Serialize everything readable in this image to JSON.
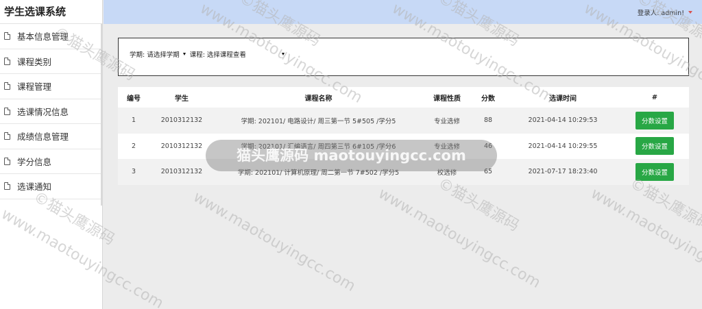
{
  "app": {
    "title": "学生选课系统"
  },
  "header": {
    "user_label": "登录人: admin!"
  },
  "sidebar": {
    "items": [
      {
        "label": "基本信息管理",
        "icon": "document-icon"
      },
      {
        "label": "课程类别",
        "icon": "document-icon"
      },
      {
        "label": "课程管理",
        "icon": "document-icon"
      },
      {
        "label": "选课情况信息",
        "icon": "document-icon"
      },
      {
        "label": "成绩信息管理",
        "icon": "document-icon"
      },
      {
        "label": "学分信息",
        "icon": "document-icon"
      },
      {
        "label": "选课通知",
        "icon": "document-icon"
      }
    ]
  },
  "filter": {
    "term_label": "学期:",
    "term_value": "请选择学期",
    "course_label": "课程:",
    "course_value": "选择课程查看"
  },
  "table": {
    "headers": [
      "编号",
      "学生",
      "课程名称",
      "课程性质",
      "分数",
      "选课时间",
      "#"
    ],
    "rows": [
      {
        "id": "1",
        "student": "2010312132",
        "course": "学期: 202101/ 电路设计/ 周三第一节 5#505 /学分5",
        "nature": "专业选修",
        "score": "88",
        "time": "2021-04-14 10:29:53",
        "action": "分数设置"
      },
      {
        "id": "2",
        "student": "2010312132",
        "course": "学期: 202101/ 汇编语言/ 周四第三节 6#105 /学分6",
        "nature": "专业选修",
        "score": "46",
        "time": "2021-04-14 10:29:55",
        "action": "分数设置"
      },
      {
        "id": "3",
        "student": "2010312132",
        "course": "学期: 202101/ 计算机原理/ 周二第一节 7#502 /学分5",
        "nature": "校选修",
        "score": "65",
        "time": "2021-07-17 18:23:40",
        "action": "分数设置"
      }
    ]
  },
  "watermark": {
    "brand": "©猫头鹰源码",
    "url": "www.maotouyingcc.com",
    "center_text": "猫头鹰源码 maotouyingcc.com"
  },
  "colors": {
    "header_bg": "#c7d9f6",
    "button_green": "#28a745",
    "caret_red": "#d9534f"
  }
}
